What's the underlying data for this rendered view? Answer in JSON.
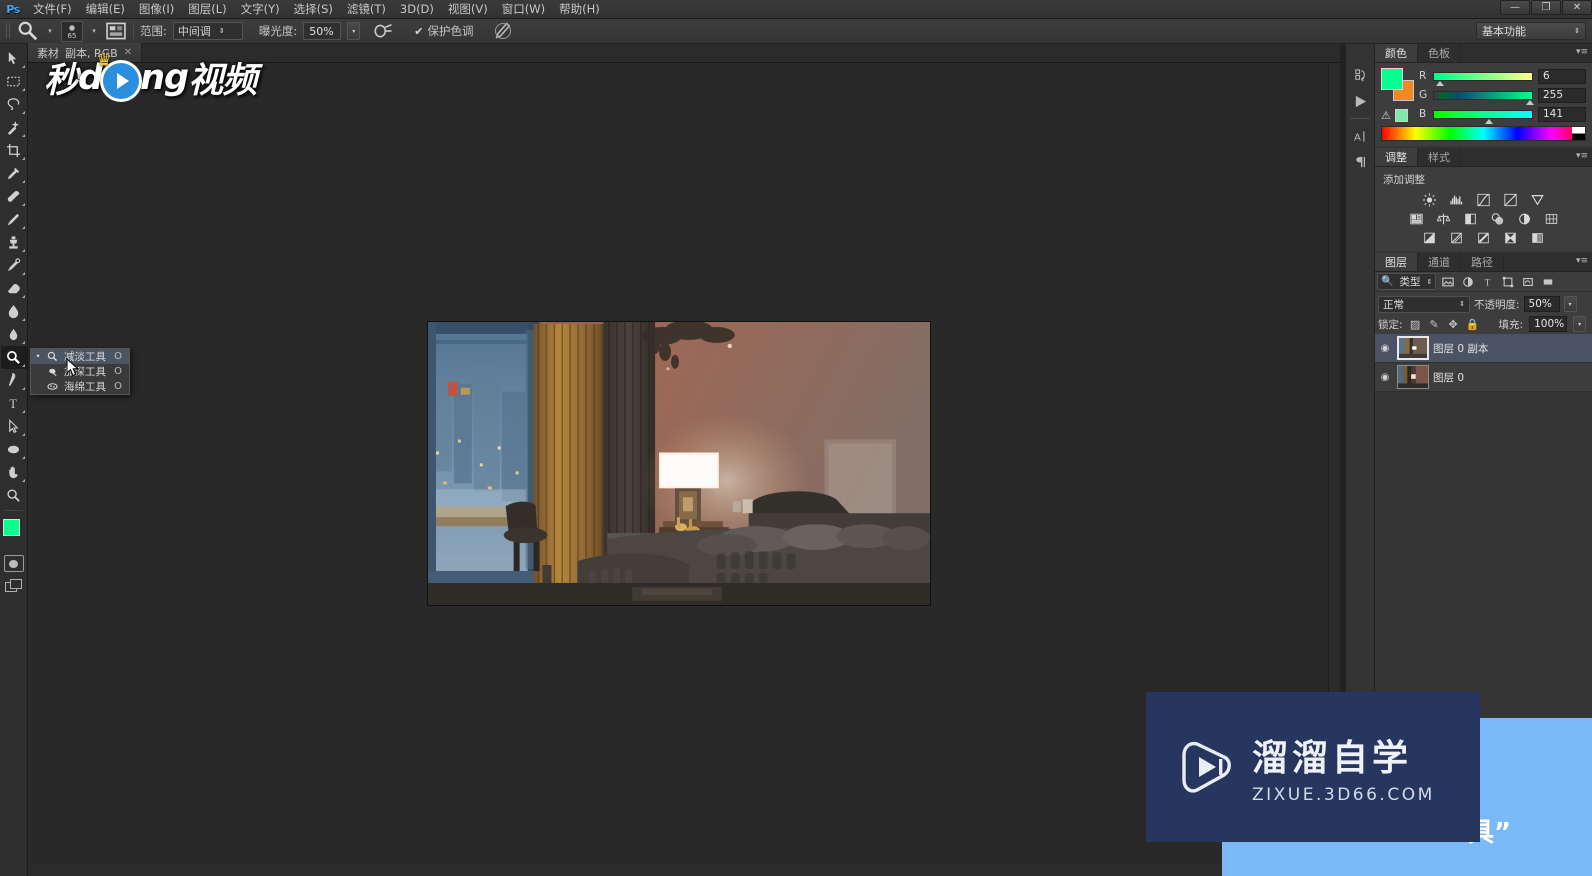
{
  "app": {
    "logo": "Ps",
    "workspace": "基本功能",
    "window_controls": [
      "—",
      "❐",
      "✕"
    ]
  },
  "menubar": {
    "items": [
      {
        "label": "文件(F)"
      },
      {
        "label": "编辑(E)"
      },
      {
        "label": "图像(I)"
      },
      {
        "label": "图层(L)"
      },
      {
        "label": "文字(Y)"
      },
      {
        "label": "选择(S)"
      },
      {
        "label": "滤镜(T)"
      },
      {
        "label": "3D(D)"
      },
      {
        "label": "视图(V)"
      },
      {
        "label": "窗口(W)"
      },
      {
        "label": "帮助(H)"
      }
    ]
  },
  "options_bar": {
    "tool_icon": "dodge-tool-icon",
    "brush_size": "65",
    "brush_preset_icon": "brush-preset-icon",
    "range_label": "范围:",
    "range_value": "中间调",
    "exposure_label": "曝光度:",
    "exposure_value": "50%",
    "airbrush_icon": "airbrush-icon",
    "protect_tones_label": "保护色调",
    "protect_tones_checked": true,
    "tablet_pressure_icon": "tablet-pressure-icon"
  },
  "document_tab": {
    "title": "素材",
    "suffix": "副本, RGB",
    "close": "✕"
  },
  "toolbar": {
    "tools": [
      {
        "name": "move-tool",
        "icon": "move-icon"
      },
      {
        "name": "marquee-tool",
        "icon": "marquee-icon"
      },
      {
        "name": "lasso-tool",
        "icon": "lasso-icon"
      },
      {
        "name": "magic-wand-tool",
        "icon": "magic-wand-icon"
      },
      {
        "name": "crop-tool",
        "icon": "crop-icon"
      },
      {
        "name": "eyedropper-tool",
        "icon": "eyedropper-icon"
      },
      {
        "name": "healing-brush-tool",
        "icon": "healing-brush-icon"
      },
      {
        "name": "brush-tool",
        "icon": "brush-icon"
      },
      {
        "name": "clone-stamp-tool",
        "icon": "clone-stamp-icon"
      },
      {
        "name": "history-brush-tool",
        "icon": "history-brush-icon"
      },
      {
        "name": "eraser-tool",
        "icon": "eraser-icon"
      },
      {
        "name": "gradient-tool",
        "icon": "gradient-icon"
      },
      {
        "name": "blur-tool",
        "icon": "blur-icon"
      },
      {
        "name": "dodge-tool",
        "icon": "dodge-icon",
        "selected": true
      },
      {
        "name": "pen-tool",
        "icon": "pen-icon"
      },
      {
        "name": "type-tool",
        "icon": "type-icon"
      },
      {
        "name": "path-selection-tool",
        "icon": "path-selection-icon"
      },
      {
        "name": "shape-tool",
        "icon": "ellipse-shape-icon"
      },
      {
        "name": "hand-tool",
        "icon": "hand-icon"
      },
      {
        "name": "zoom-tool",
        "icon": "zoom-icon"
      }
    ],
    "foreground_color": "#06ff8d",
    "background_color": "#f08a1e",
    "quick_mask_icon": "quick-mask-icon",
    "screen_mode_icon": "screen-mode-icon"
  },
  "tool_flyout": {
    "items": [
      {
        "label": "减淡工具",
        "shortcut": "O",
        "icon": "dodge-icon",
        "active": true,
        "bullet": "•"
      },
      {
        "label": "加深工具",
        "shortcut": "O",
        "icon": "burn-icon",
        "active": false,
        "bullet": ""
      },
      {
        "label": "海绵工具",
        "shortcut": "O",
        "icon": "sponge-icon",
        "active": false,
        "bullet": ""
      }
    ]
  },
  "color_panel": {
    "tabs": [
      {
        "label": "颜色",
        "active": true
      },
      {
        "label": "色板",
        "active": false
      }
    ],
    "menu_icon": "panel-menu-icon",
    "channels": [
      {
        "label": "R",
        "value": "6"
      },
      {
        "label": "G",
        "value": "255"
      },
      {
        "label": "B",
        "value": "141"
      }
    ],
    "warning_icon": "gamut-warning-icon",
    "foreground": "#06ff8d",
    "background": "#f08a1e"
  },
  "adjustments_panel": {
    "tabs": [
      {
        "label": "调整",
        "active": true
      },
      {
        "label": "样式",
        "active": false
      }
    ],
    "title": "添加调整",
    "rows": [
      [
        "brightness-contrast-icon",
        "levels-icon",
        "curves-icon",
        "exposure-icon",
        "vibrance-icon"
      ],
      [
        "hue-saturation-icon",
        "color-balance-icon",
        "black-white-icon",
        "photo-filter-icon",
        "channel-mixer-icon",
        "color-lookup-icon"
      ],
      [
        "invert-icon",
        "posterize-icon",
        "threshold-icon",
        "selective-color-icon",
        "gradient-map-icon"
      ]
    ]
  },
  "layers_panel": {
    "tabs": [
      {
        "label": "图层",
        "active": true
      },
      {
        "label": "通道",
        "active": false
      },
      {
        "label": "路径",
        "active": false
      }
    ],
    "filter_label": "类型",
    "filter_icons": [
      "pixel-filter-icon",
      "adjustment-filter-icon",
      "type-filter-icon",
      "shape-filter-icon",
      "smart-object-filter-icon",
      "filter-toggle-icon"
    ],
    "blend_mode": "正常",
    "opacity_label": "不透明度:",
    "opacity_value": "50%",
    "lock_label": "锁定:",
    "lock_icons": [
      "lock-transparent-icon",
      "lock-image-icon",
      "lock-position-icon",
      "lock-all-icon"
    ],
    "fill_label": "填充:",
    "fill_value": "100%",
    "layers": [
      {
        "name": "图层 0 副本",
        "visible": true,
        "selected": true,
        "eye": "◉"
      },
      {
        "name": "图层 0",
        "visible": true,
        "selected": false,
        "eye": "◉"
      }
    ]
  },
  "dock_strip": {
    "icons": [
      "history-icon",
      "actions-play-icon",
      "character-icon",
      "paragraph-icon"
    ]
  },
  "watermark_top": {
    "part1": "秒",
    "part2": "d",
    "part3": "ng",
    "part4": "视频",
    "crown": "♥"
  },
  "watermark_bottom": {
    "cn": "溜溜自学",
    "en": "ZIXUE.3D66.COM",
    "logo_icon": "play-triangle-logo-icon",
    "box_color": "#27365e",
    "panel_color": "#79b9f7",
    "panel_text": "具”"
  }
}
